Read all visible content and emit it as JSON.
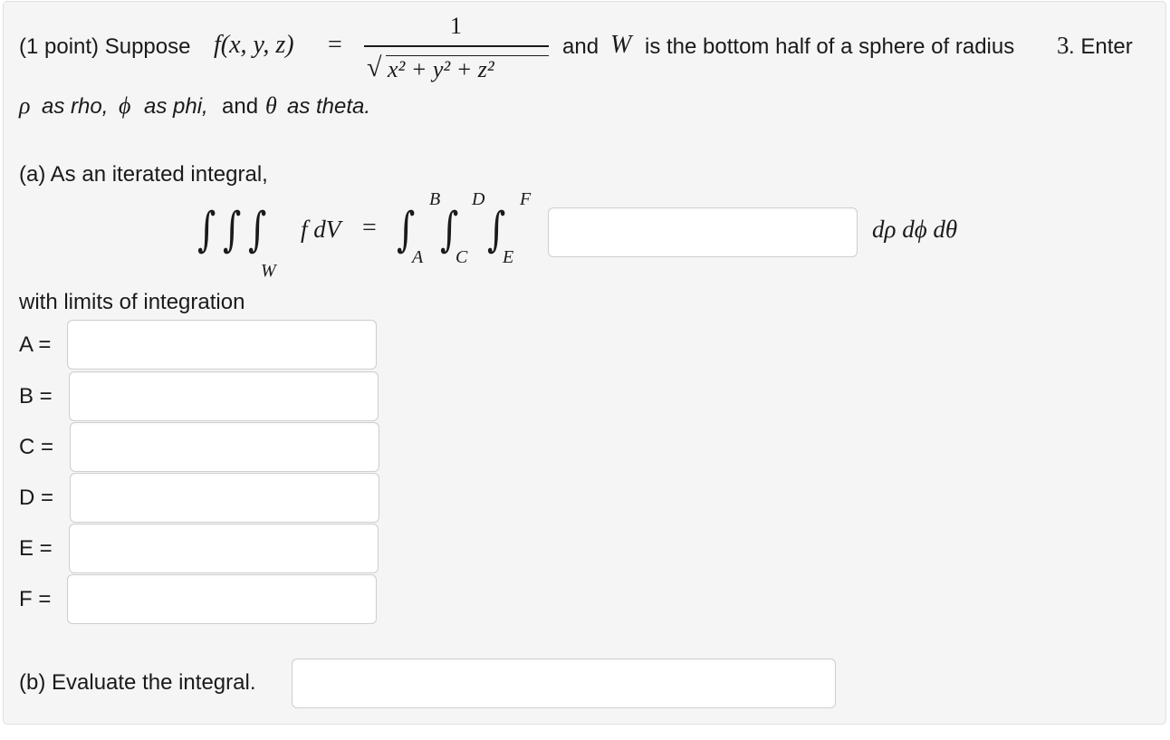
{
  "intro": {
    "prefix": "(1 point) Suppose",
    "func": "f(x, y, z)",
    "equals": "=",
    "numerator": "1",
    "sqrt_symbol": "√",
    "denominator": "x² + y² + z²",
    "after_and": "and",
    "W": "W",
    "middle": "is the bottom half of a sphere of radius",
    "radius": "3",
    "end": ". Enter"
  },
  "hint": {
    "rho_sym": "ρ",
    "rho_text": "as rho,",
    "phi_sym": "ϕ",
    "phi_text": "as phi,",
    "and": "and",
    "theta_sym": "θ",
    "theta_text": "as theta."
  },
  "part_a": {
    "label": "(a) As an iterated integral,",
    "integrand": "f dV",
    "region": "W",
    "equals": "=",
    "limits": {
      "A": "A",
      "B": "B",
      "C": "C",
      "D": "D",
      "E": "E",
      "F": "F"
    },
    "differentials": "dρ dϕ dθ",
    "integrand_value": "",
    "limits_label": "with limits of integration"
  },
  "limit_fields": [
    {
      "label": "A =",
      "value": ""
    },
    {
      "label": "B =",
      "value": ""
    },
    {
      "label": "C =",
      "value": ""
    },
    {
      "label": "D =",
      "value": ""
    },
    {
      "label": "E =",
      "value": ""
    },
    {
      "label": "F =",
      "value": ""
    }
  ],
  "part_b": {
    "label": "(b) Evaluate the integral.",
    "value": ""
  }
}
